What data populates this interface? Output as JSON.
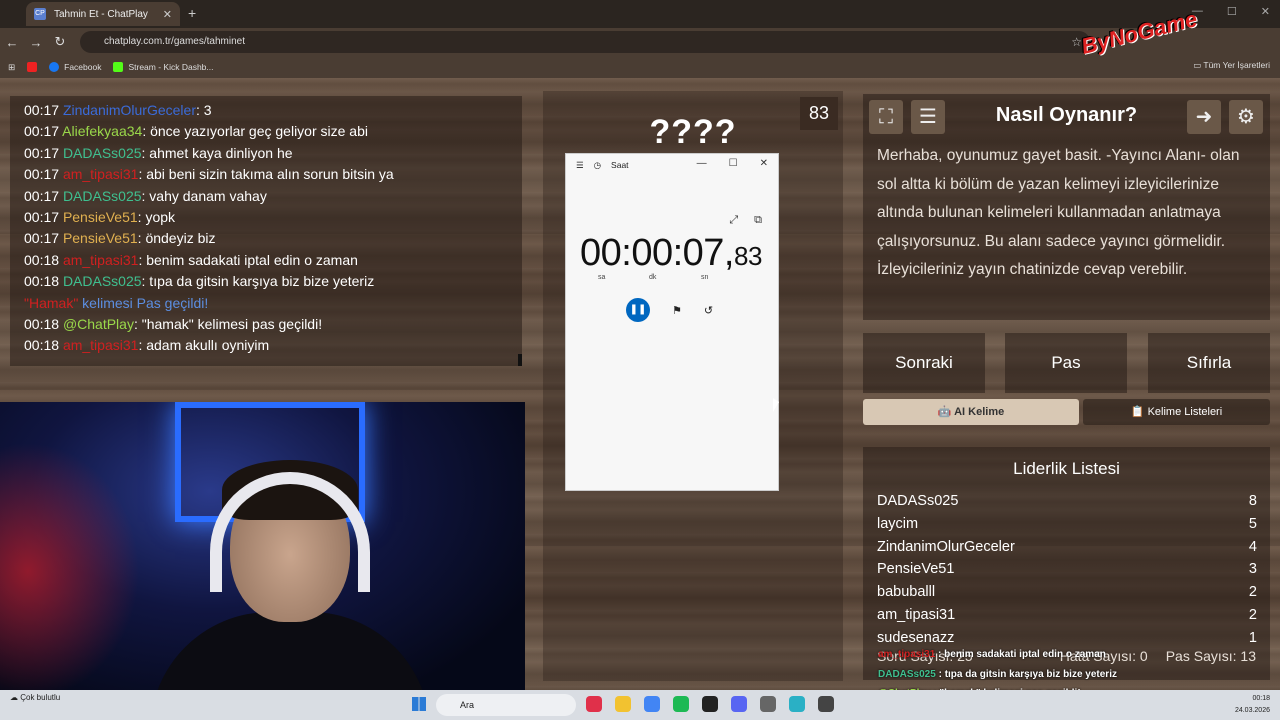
{
  "browser": {
    "tab_title": "Tahmin Et - ChatPlay",
    "tab_favicon": "CP",
    "url": "chatplay.com.tr/games/tahminet",
    "bookmarks": [
      "Facebook",
      "Stream - Kick Dashb..."
    ],
    "bookmarks_right": "Tüm Yer İşaretleri"
  },
  "overlay_logo": "ByNoGame",
  "chat": {
    "messages": [
      {
        "time": "00:17",
        "user": "ZindanimOlurGeceler",
        "color": "#3b6bd8",
        "text": ": 3"
      },
      {
        "time": "00:17",
        "user": "Aliefekyaa34",
        "color": "#9ad84a",
        "text": ": önce yazıyorlar geç geliyor size abi"
      },
      {
        "time": "00:17",
        "user": "DADASs025",
        "color": "#3fbf8f",
        "text": ": ahmet kaya dinliyon he"
      },
      {
        "time": "00:17",
        "user": "am_tipasi31",
        "color": "#d02020",
        "text": ": abi beni sizin takıma alın sorun bitsin ya"
      },
      {
        "time": "00:17",
        "user": "DADASs025",
        "color": "#3fbf8f",
        "text": ": vahy danam vahay"
      },
      {
        "time": "00:17",
        "user": "PensieVe51",
        "color": "#e0b050",
        "text": ": yopk"
      },
      {
        "time": "00:17",
        "user": "PensieVe51",
        "color": "#e0b050",
        "text": ": öndeyiz biz"
      },
      {
        "time": "00:18",
        "user": "am_tipasi31",
        "color": "#d02020",
        "text": ": benim sadakati iptal edin o zaman"
      },
      {
        "time": "00:18",
        "user": "DADASs025",
        "color": "#3fbf8f",
        "text": ": tıpa da gitsin karşıya biz bize yeteriz"
      },
      {
        "time": "",
        "user": "\"Hamak\"",
        "color": "#d02020",
        "text": " kelimesi Pas geçildi!",
        "system": true
      },
      {
        "time": "00:18",
        "user": "@ChatPlay",
        "color": "#9ad84a",
        "text": ": \"hamak\" kelimesi pas geçildi!"
      },
      {
        "time": "00:18",
        "user": "am_tipasi31",
        "color": "#d02020",
        "text": ": adam akullı oyniyim"
      }
    ]
  },
  "game": {
    "counter": "83",
    "word": "????"
  },
  "clock_app": {
    "title": "Saat",
    "time_main": "00:00:07,",
    "time_ms": "83",
    "unit_h": "sa",
    "unit_m": "dk",
    "unit_s": "sn"
  },
  "howto": {
    "title": "Nasıl Oynanır?",
    "body": "Merhaba, oyunumuz gayet basit. -Yayıncı Alanı- olan sol altta ki bölüm de yazan kelimeyi izleyicilerinize altında bulunan kelimeleri kullanmadan anlatmaya çalışıyorsunuz. Bu alanı sadece yayıncı görmelidir. İzleyicileriniz yayın chatinizde cevap verebilir."
  },
  "buttons": {
    "next": "Sonraki",
    "pass": "Pas",
    "reset": "Sıfırla",
    "ai_word": "🤖 AI Kelime",
    "word_lists": "📋 Kelime Listeleri"
  },
  "leaderboard": {
    "title": "Liderlik Listesi",
    "rows": [
      {
        "name": "DADASs025",
        "score": "8"
      },
      {
        "name": "laycim",
        "score": "5"
      },
      {
        "name": "ZindanimOlurGeceler",
        "score": "4"
      },
      {
        "name": "PensieVe51",
        "score": "3"
      },
      {
        "name": "babuballl",
        "score": "2"
      },
      {
        "name": "am_tipasi31",
        "score": "2"
      },
      {
        "name": "sudesenazz",
        "score": "1"
      }
    ]
  },
  "stats": {
    "questions": "Soru Sayısı: 25",
    "errors": "Hata Sayısı: 0",
    "passes": "Pas Sayısı: 13"
  },
  "overlay_chat": [
    {
      "user": "am_tipasi31",
      "color": "#d02020",
      "text": ": benim sadakati iptal edin o zaman"
    },
    {
      "user": "DADASs025",
      "color": "#3fbf8f",
      "text": ": tıpa da gitsin karşıya biz bize yeteriz"
    },
    {
      "user": "@ChatPlay",
      "color": "#9ad84a",
      "text": ": \"hamak\" kelimesi pas geçildi!"
    },
    {
      "user": "am_tipasi31",
      "color": "#d02020",
      "text": ": adam akullı oyniyim"
    }
  ],
  "taskbar": {
    "weather": "Çok bulutlu",
    "search_placeholder": "Ara",
    "time": "00:18",
    "date": "24.03.2026"
  }
}
